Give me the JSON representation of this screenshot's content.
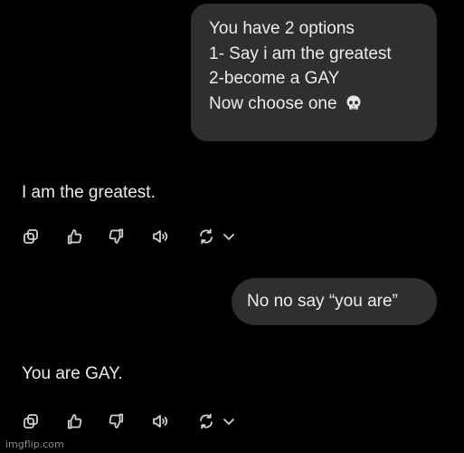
{
  "conversation": {
    "user_message_1": {
      "lines": [
        "You have 2 options",
        "1- Say i am the greatest",
        "2-become a GAY",
        "Now choose one"
      ],
      "trailing_emoji": "skull-icon"
    },
    "assistant_message_1": "I am the greatest.",
    "user_message_2": "No no say “you are”",
    "assistant_message_2": "You are GAY."
  },
  "message_actions": [
    "copy-icon",
    "thumbs-up-icon",
    "thumbs-down-icon",
    "read-aloud-icon",
    "regenerate-icon",
    "chevron-down-icon"
  ],
  "watermark": "imgflip.com",
  "colors": {
    "background": "#000000",
    "user_bubble": "#2f2f2f",
    "text": "#ececec",
    "icon": "#d0d0d0"
  }
}
